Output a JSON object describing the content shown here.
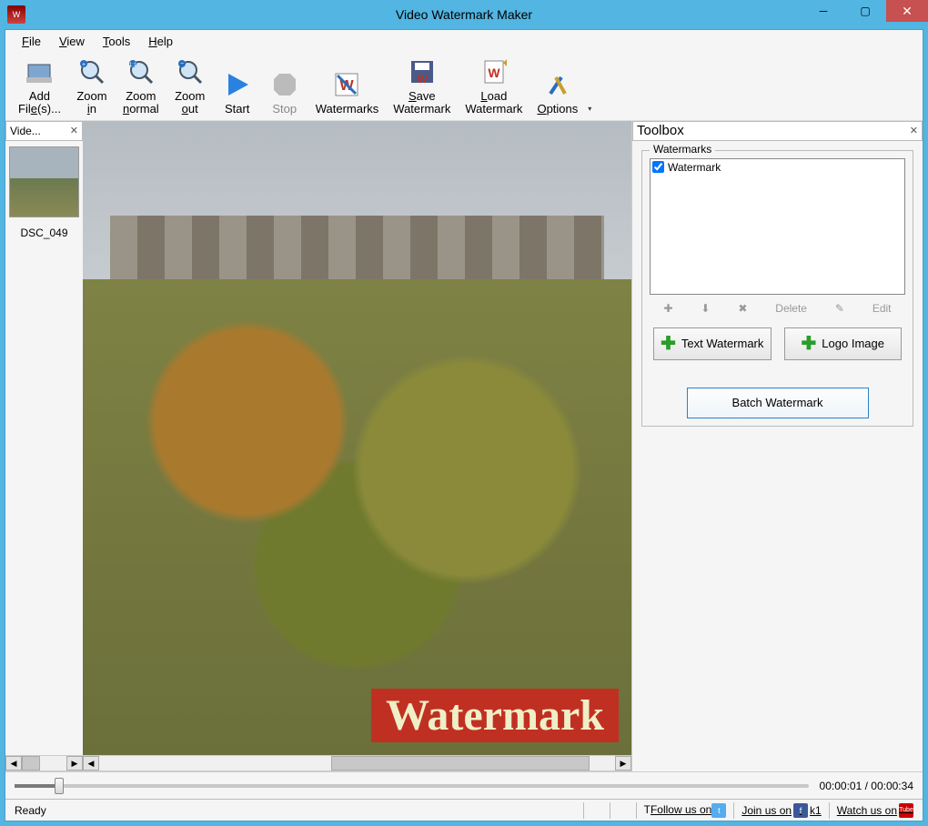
{
  "window": {
    "title": "Video Watermark Maker"
  },
  "menu": {
    "file": "File",
    "view": "View",
    "tools": "Tools",
    "help": "Help"
  },
  "toolbar": {
    "addfiles": "Add\nFile(s)...",
    "zoomin": "Zoom\nin",
    "zoomnormal": "Zoom\nnormal",
    "zoomout": "Zoom\nout",
    "start": "Start",
    "stop": "Stop",
    "watermarks": "Watermarks",
    "savewm": "Save\nWatermark",
    "loadwm": "Load\nWatermark",
    "options": "Options"
  },
  "filepanel": {
    "tab": "Vide...",
    "thumb_label": "DSC_049"
  },
  "preview": {
    "watermark_text": "Watermark"
  },
  "toolbox": {
    "title": "Toolbox",
    "group": "Watermarks",
    "items": [
      {
        "checked": true,
        "label": "Watermark"
      }
    ],
    "op_delete": "Delete",
    "op_edit": "Edit",
    "btn_text": "Text Watermark",
    "btn_logo": "Logo Image",
    "btn_batch": "Batch Watermark"
  },
  "timeline": {
    "current": "00:00:01",
    "total": "00:00:34"
  },
  "status": {
    "ready": "Ready",
    "t_left": "T",
    "follow": "Follow us on",
    "join": "Join us on",
    "fb_extra": "k1",
    "watch": "Watch us on"
  }
}
